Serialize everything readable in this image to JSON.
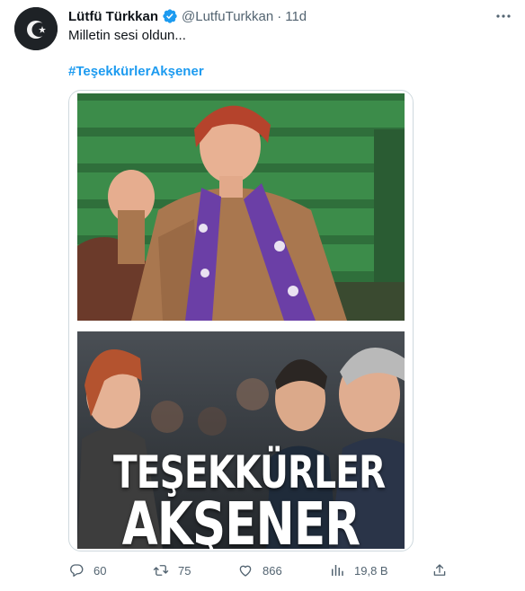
{
  "author": {
    "name": "Lütfü Türkkan",
    "handle": "@LutfuTurkkan",
    "separator": "·",
    "time": "11d"
  },
  "tweet": {
    "text": "Milletin sesi oldun...",
    "hashtag": "#TeşekkürlerAkşener"
  },
  "media": {
    "overlay_line1": "TEŞEKKÜRLER",
    "overlay_line2": "AKŞENER"
  },
  "actions": {
    "replies": "60",
    "retweets": "75",
    "likes": "866",
    "views": "19,8 B"
  },
  "colors": {
    "accent": "#1d9bf0",
    "muted": "#536471",
    "border": "#cfd9de",
    "verified": "#1d9bf0"
  },
  "icons": [
    "more-icon",
    "verified-badge-icon",
    "reply-icon",
    "retweet-icon",
    "like-icon",
    "views-icon",
    "share-icon"
  ]
}
